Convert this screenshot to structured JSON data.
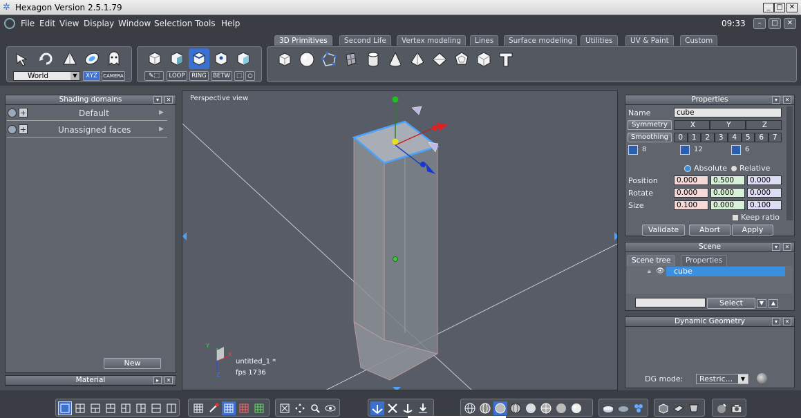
{
  "window": {
    "title": "Hexagon Version 2.5.1.79"
  },
  "menubar": {
    "items": [
      "File",
      "Edit",
      "View",
      "Display",
      "Window",
      "Selection",
      "Tools",
      "Help"
    ],
    "clock": "09:33"
  },
  "tabs": [
    "3D Primitives",
    "Second Life",
    "Vertex modeling",
    "Lines",
    "Surface modeling",
    "Utilities",
    "UV & Paint",
    "Custom"
  ],
  "toolbar": {
    "coord_select": "World",
    "xyz_label": "XYZ",
    "camera_label": "CAMERA",
    "loop_label": "LOOP",
    "ring_label": "RING",
    "betw_label": "BETW"
  },
  "shading_panel": {
    "title": "Shading domains",
    "items": [
      "Default",
      "Unassigned faces"
    ],
    "new_button": "New"
  },
  "material_panel": {
    "title": "Material"
  },
  "viewport": {
    "label": "Perspective view",
    "file": "untitled_1 *",
    "fps": "fps 1736",
    "axis_x": "X",
    "axis_y": "Y",
    "axis_z": "Z"
  },
  "properties": {
    "title": "Properties",
    "name_label": "Name",
    "name_value": "cube",
    "symmetry_label": "Symmetry",
    "sym_axes": [
      "X",
      "Y",
      "Z"
    ],
    "smoothing_label": "Smoothing",
    "smoothing_levels": [
      "0",
      "1",
      "2",
      "3",
      "4",
      "5",
      "6",
      "7"
    ],
    "counts": [
      "8",
      "12",
      "6"
    ],
    "absolute_label": "Absolute",
    "relative_label": "Relative",
    "position_label": "Position",
    "rotate_label": "Rotate",
    "size_label": "Size",
    "position": [
      "0.000",
      "0.500",
      "0.000"
    ],
    "rotate": [
      "0.000",
      "0.000",
      "0.000"
    ],
    "size": [
      "0.100",
      "0.000",
      "0.100"
    ],
    "keep_ratio": "Keep ratio",
    "validate": "Validate",
    "abort": "Abort",
    "apply": "Apply"
  },
  "scene": {
    "title": "Scene",
    "tab_tree": "Scene tree",
    "tab_props": "Properties",
    "item": "cube",
    "select_button": "Select"
  },
  "dynamic_geometry": {
    "title": "Dynamic Geometry",
    "mode_label": "DG mode:",
    "mode_value": "Restric..."
  },
  "colors": {
    "accent": "#3b8fe0",
    "selection": "#4aa3ff",
    "bg": "#575c66"
  }
}
